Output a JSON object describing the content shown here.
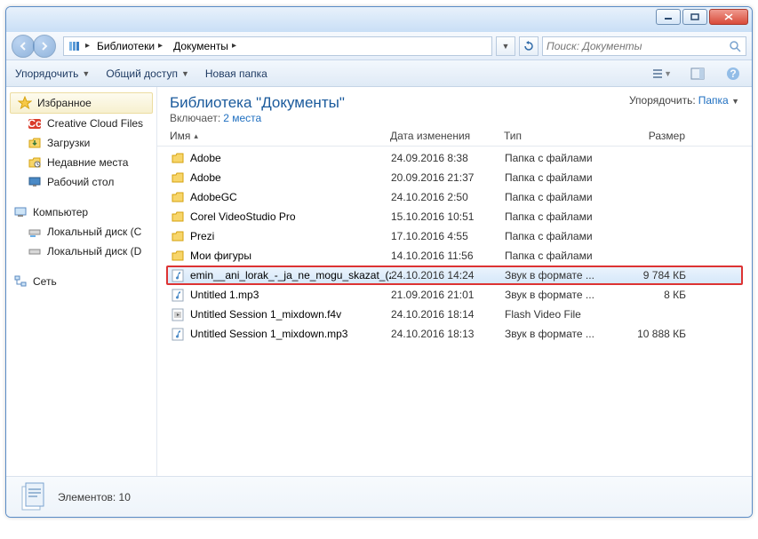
{
  "window_controls": {
    "min": "minimize",
    "max": "maximize",
    "close": "close"
  },
  "breadcrumbs": [
    "Библиотеки",
    "Документы"
  ],
  "search": {
    "placeholder": "Поиск: Документы"
  },
  "toolbar": {
    "organize": "Упорядочить",
    "share": "Общий доступ",
    "newfolder": "Новая папка"
  },
  "sidebar": {
    "favorites": {
      "label": "Избранное",
      "items": [
        {
          "label": "Creative Cloud Files",
          "icon": "cc"
        },
        {
          "label": "Загрузки",
          "icon": "downloads"
        },
        {
          "label": "Недавние места",
          "icon": "recent"
        },
        {
          "label": "Рабочий стол",
          "icon": "desktop"
        }
      ]
    },
    "computer": {
      "label": "Компьютер",
      "items": [
        {
          "label": "Локальный диск (C",
          "icon": "drive"
        },
        {
          "label": "Локальный диск (D",
          "icon": "drive"
        }
      ]
    },
    "network": {
      "label": "Сеть"
    }
  },
  "library": {
    "title": "Библиотека \"Документы\"",
    "includes_label": "Включает:",
    "includes_link": "2 места",
    "arrange_label": "Упорядочить:",
    "arrange_value": "Папка"
  },
  "columns": {
    "name": "Имя",
    "date": "Дата изменения",
    "type": "Тип",
    "size": "Размер"
  },
  "files": [
    {
      "name": "Adobe",
      "date": "24.09.2016 8:38",
      "type": "Папка с файлами",
      "size": "",
      "icon": "folder"
    },
    {
      "name": "Adobe",
      "date": "20.09.2016 21:37",
      "type": "Папка с файлами",
      "size": "",
      "icon": "folder"
    },
    {
      "name": "AdobeGC",
      "date": "24.10.2016 2:50",
      "type": "Папка с файлами",
      "size": "",
      "icon": "folder"
    },
    {
      "name": "Corel VideoStudio Pro",
      "date": "15.10.2016 10:51",
      "type": "Папка с файлами",
      "size": "",
      "icon": "folder"
    },
    {
      "name": "Prezi",
      "date": "17.10.2016 4:55",
      "type": "Папка с файлами",
      "size": "",
      "icon": "folder"
    },
    {
      "name": "Мои фигуры",
      "date": "14.10.2016 11:56",
      "type": "Папка с файлами",
      "size": "",
      "icon": "folder"
    },
    {
      "name": "emin__ani_lorak_-_ja_ne_mogu_skazat_(z...",
      "date": "24.10.2016 14:24",
      "type": "Звук в формате ...",
      "size": "9 784 КБ",
      "icon": "audio",
      "selected": true,
      "highlighted": true
    },
    {
      "name": "Untitled 1.mp3",
      "date": "21.09.2016 21:01",
      "type": "Звук в формате ...",
      "size": "8 КБ",
      "icon": "audio"
    },
    {
      "name": "Untitled Session 1_mixdown.f4v",
      "date": "24.10.2016 18:14",
      "type": "Flash Video File",
      "size": "",
      "icon": "video"
    },
    {
      "name": "Untitled Session 1_mixdown.mp3",
      "date": "24.10.2016 18:13",
      "type": "Звук в формате ...",
      "size": "10 888 КБ",
      "icon": "audio"
    }
  ],
  "status": {
    "label": "Элементов:",
    "count": "10"
  }
}
